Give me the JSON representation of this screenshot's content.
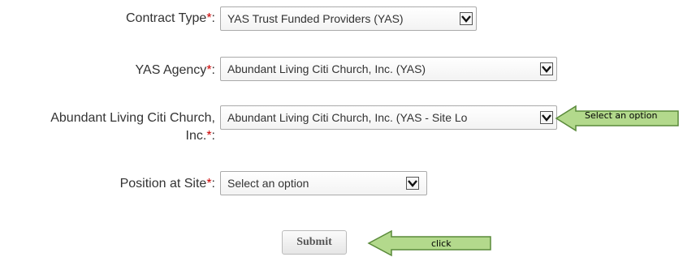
{
  "form": {
    "contract_type": {
      "label": "Contract Type",
      "required_mark": "*",
      "colon": ":",
      "value": "YAS Trust Funded Providers (YAS)"
    },
    "agency": {
      "label": "YAS Agency",
      "required_mark": "*",
      "colon": ":",
      "value": "Abundant Living Citi Church, Inc. (YAS)"
    },
    "site": {
      "label_line1": "Abundant Living Citi Church,",
      "label_line2": "Inc.",
      "required_mark": "*",
      "colon": ":",
      "value": "Abundant Living Citi Church, Inc. (YAS - Site Lo"
    },
    "position": {
      "label": "Position at Site",
      "required_mark": "*",
      "colon": ":",
      "value": "Select an option"
    },
    "submit_label": "Submit"
  },
  "annotations": {
    "select_hint": "Select an option",
    "click_hint": "click",
    "arrow_fill": "#b3d98c",
    "arrow_stroke": "#5a8a3a"
  },
  "colors": {
    "required": "#cc0000",
    "text": "#333333"
  },
  "icons": {
    "dropdown": "chevron-down-icon",
    "annotation_arrow": "left-arrow-icon"
  }
}
